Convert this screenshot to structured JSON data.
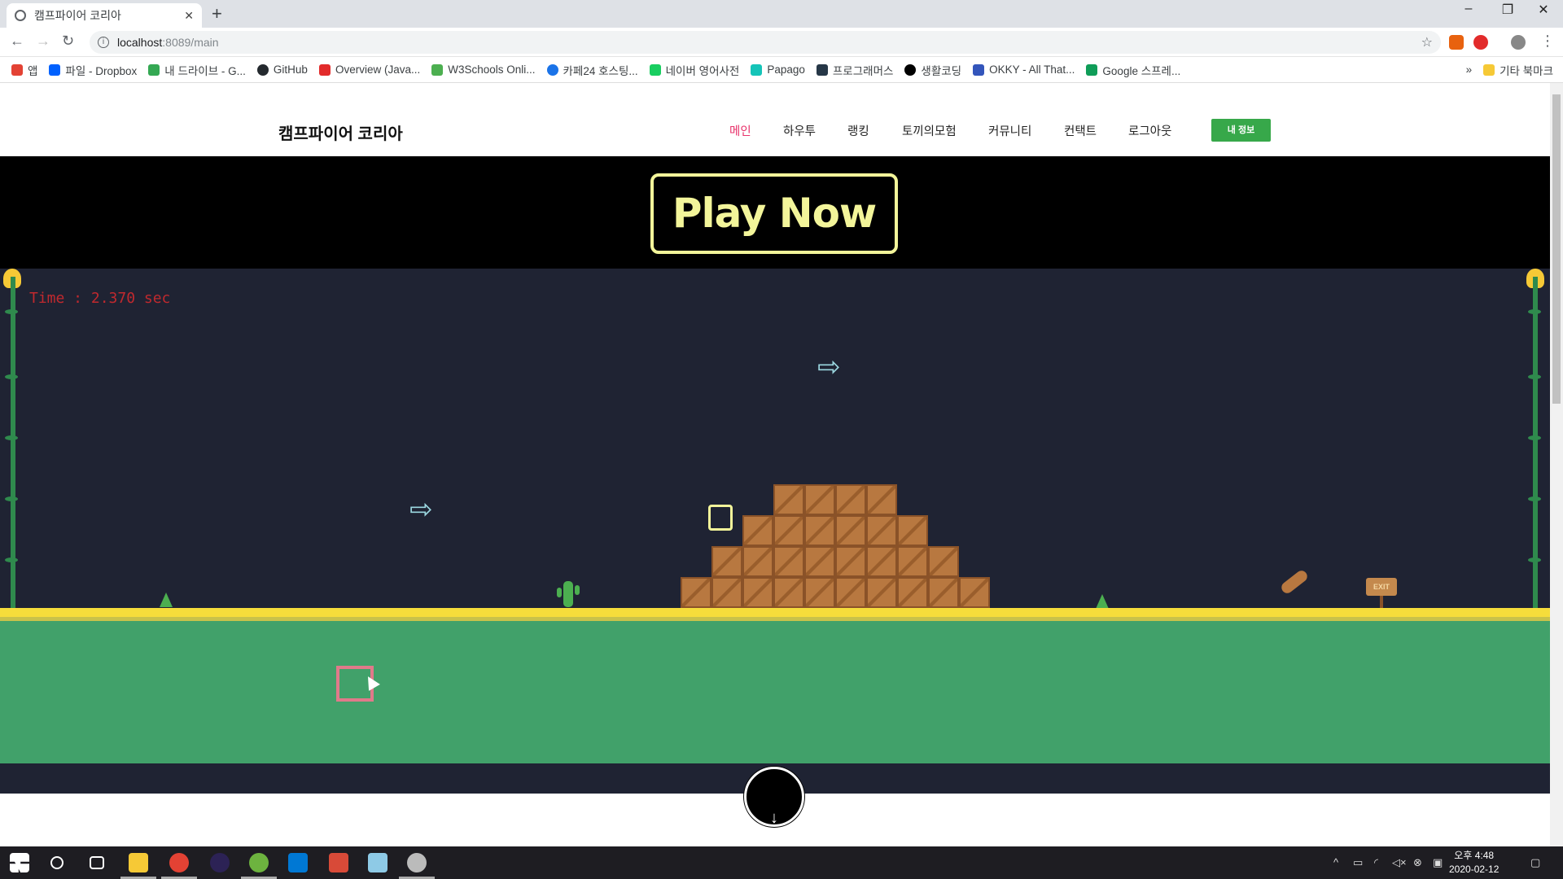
{
  "browser": {
    "tab_title": "캠프파이어 코리아",
    "close_glyph": "✕",
    "new_tab_glyph": "+",
    "url_host": "localhost",
    "url_rest": ":8089/main",
    "window_controls": [
      "–",
      "❐",
      "✕"
    ]
  },
  "bookmarks": [
    {
      "label": "앱",
      "color": "#e34234"
    },
    {
      "label": "파일 - Dropbox",
      "color": "#0061fe"
    },
    {
      "label": "내 드라이브 - G...",
      "color": "#34a853"
    },
    {
      "label": "GitHub",
      "color": "#24292e"
    },
    {
      "label": "Overview (Java...",
      "color": "#e22b2b"
    },
    {
      "label": "W3Schools Onli...",
      "color": "#4caf50"
    },
    {
      "label": "카페24 호스팅...",
      "color": "#1a73e8"
    },
    {
      "label": "네이버 영어사전",
      "color": "#19ce60"
    },
    {
      "label": "Papago",
      "color": "#15c4b8"
    },
    {
      "label": "프로그래머스",
      "color": "#263747"
    },
    {
      "label": "생활코딩",
      "color": "#000000"
    },
    {
      "label": "OKKY - All That...",
      "color": "#3355bb"
    },
    {
      "label": "Google 스프레...",
      "color": "#0f9d58"
    }
  ],
  "bookmarks_more": "»",
  "bookmarks_other": "기타 북마크",
  "site": {
    "brand": "캠프파이어 코리아",
    "nav": [
      {
        "label": "메인",
        "active": true
      },
      {
        "label": "하우투",
        "active": false
      },
      {
        "label": "랭킹",
        "active": false
      },
      {
        "label": "토끼의모험",
        "active": false
      },
      {
        "label": "커뮤니티",
        "active": false
      },
      {
        "label": "컨택트",
        "active": false
      },
      {
        "label": "로그아웃",
        "active": false
      }
    ],
    "my_info_button": "내 정보",
    "play_button": "Play Now",
    "accent_color": "#e8336b",
    "button_color": "#37a84a"
  },
  "game": {
    "timer_text": "Time : 2.370 sec",
    "exit_sign": "EXIT",
    "scroll_down_glyph": "↓"
  },
  "taskbar": {
    "time": "오후 4:48",
    "date": "2020-02-12"
  }
}
